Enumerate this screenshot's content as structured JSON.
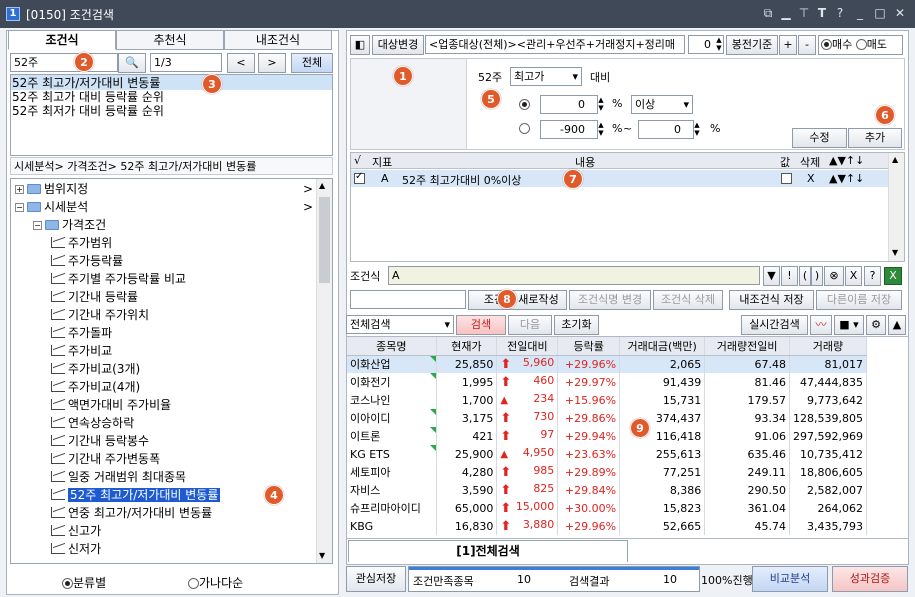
{
  "window": {
    "code": "[0150]",
    "title": "조건검색",
    "app_icon": "1"
  },
  "left": {
    "tabs": [
      "조건식",
      "추천식",
      "내조건식"
    ],
    "search_value": "52주",
    "page_value": "1/3",
    "prev_label": "<",
    "next_label": ">",
    "all_label": "전체",
    "results": [
      "52주 최고가/저가대비 변동률",
      "52주 최고가 대비 등락률 순위",
      "52주 최저가 대비 등락률 순위"
    ],
    "breadcrumb": "시세분석> 가격조건> 52주 최고가/저가대비 변동률",
    "tree": [
      {
        "label": "범위지정",
        "type": "folder",
        "level": 0,
        "arrow": ">"
      },
      {
        "label": "시세분석",
        "type": "folder",
        "level": 0,
        "arrow": ">"
      },
      {
        "label": "가격조건",
        "type": "folder",
        "level": 1
      },
      {
        "label": "주가범위",
        "type": "item",
        "level": 2
      },
      {
        "label": "주가등락률",
        "type": "item",
        "level": 2
      },
      {
        "label": "주기별 주가등락률 비교",
        "type": "item",
        "level": 2
      },
      {
        "label": "기간내 등락률",
        "type": "item",
        "level": 2
      },
      {
        "label": "기간내 주가위치",
        "type": "item",
        "level": 2
      },
      {
        "label": "주가돌파",
        "type": "item",
        "level": 2
      },
      {
        "label": "주가비교",
        "type": "item",
        "level": 2
      },
      {
        "label": "주가비교(3개)",
        "type": "item",
        "level": 2
      },
      {
        "label": "주가비교(4개)",
        "type": "item",
        "level": 2
      },
      {
        "label": "액면가대비 주가비율",
        "type": "item",
        "level": 2
      },
      {
        "label": "연속상승하락",
        "type": "item",
        "level": 2
      },
      {
        "label": "기간내 등락봉수",
        "type": "item",
        "level": 2
      },
      {
        "label": "기간내 주가변동폭",
        "type": "item",
        "level": 2
      },
      {
        "label": "일중 거래범위 최대종목",
        "type": "item",
        "level": 2
      },
      {
        "label": "52주 최고가/저가대비 변동률",
        "type": "item",
        "level": 2,
        "selected": true
      },
      {
        "label": "연중 최고가/저가대비 변동률",
        "type": "item",
        "level": 2
      },
      {
        "label": "신고가",
        "type": "item",
        "level": 2
      },
      {
        "label": "신저가",
        "type": "item",
        "level": 2
      }
    ],
    "sort_options": [
      "분류별",
      "가나다순"
    ]
  },
  "right": {
    "toolbar": {
      "target_change": "대상변경",
      "target_text": "<업종대상(전체)><관리+우선주+거래정지+정리매",
      "bong_value": "0",
      "bong_label": "봉전기준",
      "plus": "+",
      "minus": "-",
      "buy": "매수",
      "sell": "매도"
    },
    "condition": {
      "period_label": "52주",
      "price_type": "최고가",
      "compare_label": "대비",
      "val1": "0",
      "unit1": "%",
      "range_type": "이상",
      "val2": "-900",
      "unit2": "%",
      "tilde": "~",
      "val3": "0",
      "unit3": "%",
      "modify": "수정",
      "add": "추가"
    },
    "cond_table": {
      "headers": [
        "√",
        "지표",
        "내용",
        "값",
        "삭제",
        "▲▼↑↓"
      ],
      "row": {
        "checked": true,
        "id": "A",
        "content": "52주 최고가대비 0%이상",
        "del": "X",
        "moves": "▲▼↑↓"
      }
    },
    "formula": {
      "label": "조건식",
      "value": "A",
      "ops": [
        "▼",
        "!",
        "(",
        ")",
        "⊗",
        "X",
        "?"
      ]
    },
    "actions": {
      "name_input": "",
      "search_btn": "조건",
      "new_btn": "새로작성",
      "rename_btn": "조건식명 변경",
      "delete_btn": "조건식 삭제",
      "save_btn": "내조건식 저장",
      "saveas_btn": "다른이름 저장"
    },
    "search_bar": {
      "scope": "전체검색",
      "search": "검색",
      "next": "다음",
      "reset": "초기화",
      "realtime": "실시간검색"
    },
    "results": {
      "headers": [
        "종목명",
        "현재가",
        "전일대비",
        "등락률",
        "거래대금(백만)",
        "거래량전일비",
        "거래량"
      ],
      "rows": [
        [
          "이화산업",
          "25,850",
          "5,960",
          "+29.96%",
          "2,065",
          "67.48",
          "81,017"
        ],
        [
          "이화전기",
          "1,995",
          "460",
          "+29.97%",
          "91,439",
          "81.46",
          "47,444,835"
        ],
        [
          "코스나인",
          "1,700",
          "234",
          "+15.96%",
          "15,731",
          "179.57",
          "9,773,642"
        ],
        [
          "이아이디",
          "3,175",
          "730",
          "+29.86%",
          "374,437",
          "93.34",
          "128,539,805"
        ],
        [
          "이트론",
          "421",
          "97",
          "+29.94%",
          "116,418",
          "91.06",
          "297,592,969"
        ],
        [
          "KG ETS",
          "25,900",
          "4,950",
          "+23.63%",
          "255,613",
          "635.46",
          "10,735,412"
        ],
        [
          "세토피아",
          "4,280",
          "985",
          "+29.89%",
          "77,251",
          "249.11",
          "18,806,605"
        ],
        [
          "자비스",
          "3,590",
          "825",
          "+29.84%",
          "8,386",
          "290.50",
          "2,582,007"
        ],
        [
          "슈프리마아이디",
          "65,000",
          "15,000",
          "+30.00%",
          "15,823",
          "361.04",
          "264,062"
        ],
        [
          "KBG",
          "16,830",
          "3,880",
          "+29.96%",
          "52,665",
          "45.74",
          "3,435,793"
        ]
      ],
      "arrow_types": [
        "bold",
        "bold",
        "thin",
        "bold",
        "bold",
        "thin",
        "bold",
        "bold",
        "bold",
        "bold"
      ],
      "flagged": [
        0,
        1,
        3,
        4,
        5
      ]
    },
    "bottom_tab": "[1]전체검색",
    "status": {
      "watch_save": "관심저장",
      "cond_label": "조건만족종목",
      "cond_count": "10",
      "result_label": "검색결과",
      "result_count": "10",
      "progress_text": "100%진행",
      "progress": 1.0,
      "compare": "비교분석",
      "verify": "성과검증"
    }
  },
  "markers": [
    "1",
    "2",
    "3",
    "4",
    "5",
    "6",
    "7",
    "8",
    "9"
  ]
}
